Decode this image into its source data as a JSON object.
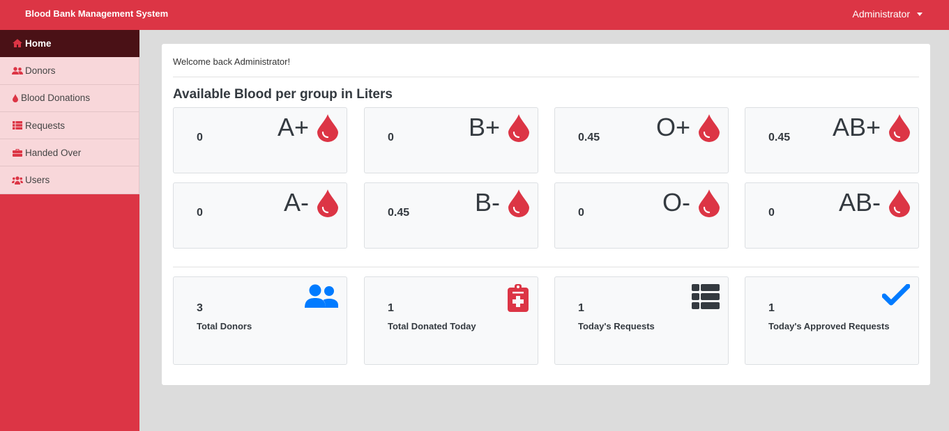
{
  "app": {
    "title": "Blood Bank Management System",
    "user_menu_label": "Administrator",
    "accent_color": "#dc3545"
  },
  "sidebar": {
    "items": [
      {
        "label": "Home",
        "icon": "home-icon",
        "active": true
      },
      {
        "label": "Donors",
        "icon": "users-icon",
        "active": false
      },
      {
        "label": "Blood Donations",
        "icon": "tint-icon",
        "active": false
      },
      {
        "label": "Requests",
        "icon": "list-icon",
        "active": false
      },
      {
        "label": "Handed Over",
        "icon": "toolbox-icon",
        "active": false
      },
      {
        "label": "Users",
        "icon": "users-group-icon",
        "active": false
      }
    ]
  },
  "main": {
    "welcome": "Welcome back Administrator!",
    "heading": "Available Blood per group in Liters",
    "blood_groups": [
      {
        "group": "A+",
        "value": "0"
      },
      {
        "group": "B+",
        "value": "0"
      },
      {
        "group": "O+",
        "value": "0.45"
      },
      {
        "group": "AB+",
        "value": "0.45"
      },
      {
        "group": "A-",
        "value": "0"
      },
      {
        "group": "B-",
        "value": "0.45"
      },
      {
        "group": "O-",
        "value": "0"
      },
      {
        "group": "AB-",
        "value": "0"
      }
    ],
    "stats": [
      {
        "value": "3",
        "label": "Total Donors",
        "icon": "user-friends-icon",
        "color": "#007bff"
      },
      {
        "value": "1",
        "label": "Total Donated Today",
        "icon": "clipboard-medical-icon",
        "color": "#dc3545"
      },
      {
        "value": "1",
        "label": "Today's Requests",
        "icon": "th-list-icon",
        "color": "#343a40"
      },
      {
        "value": "1",
        "label": "Today's Approved Requests",
        "icon": "check-icon",
        "color": "#007bff"
      }
    ]
  }
}
